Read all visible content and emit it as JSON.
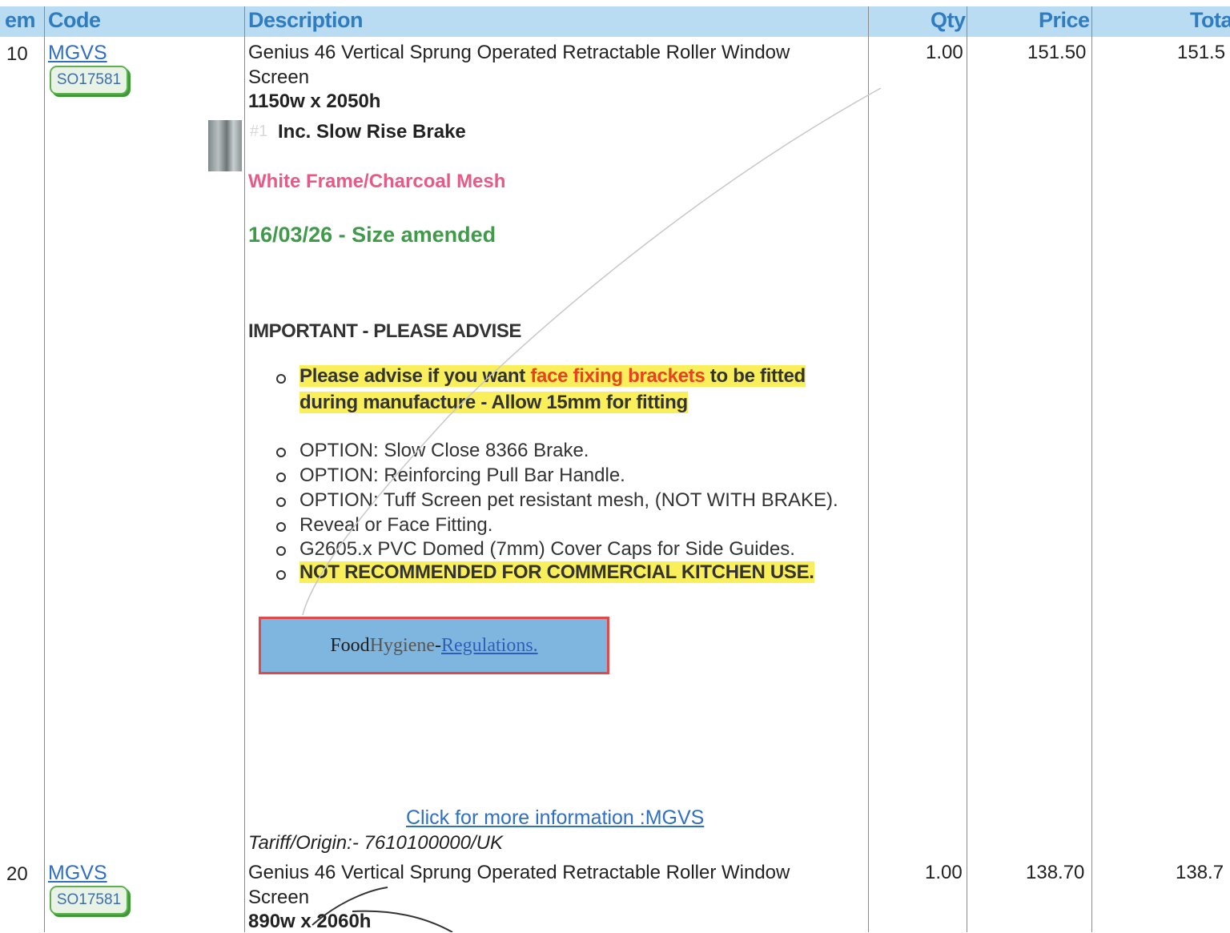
{
  "header": {
    "item": "em",
    "code": "Code",
    "description": "Description",
    "qty": "Qty",
    "price": "Price",
    "total": "Tota"
  },
  "rows": [
    {
      "item": "10",
      "code": "MGVS",
      "so": "SO17581",
      "desc_line1": "Genius 46 Vertical Sprung Operated Retractable Roller Window",
      "desc_line2": "Screen",
      "size": "1150w x 2050h",
      "option_num": "#1",
      "option": "Inc. Slow Rise Brake",
      "color": "White Frame/Charcoal Mesh",
      "note": "16/03/26 - Size amended",
      "important": "IMPORTANT - PLEASE ADVISE",
      "advise_a": "Please advise if you want ",
      "advise_b": "face fixing brackets",
      "advise_c": " to be fitted",
      "advise_d": "during manufacture - Allow 15mm for fitting",
      "options": [
        "OPTION: Slow Close 8366 Brake.",
        "OPTION: Reinforcing Pull Bar Handle.",
        "OPTION: Tuff Screen pet resistant mesh, (NOT WITH BRAKE).",
        "Reveal or Face Fitting.",
        "G2605.x PVC Domed (7mm) Cover Caps for Side Guides."
      ],
      "warning": "NOT RECOMMENDED FOR COMMERCIAL KITCHEN USE.",
      "food_a": "Food ",
      "food_b": "Hygiene",
      "food_c": " - ",
      "food_link": "Regulations.",
      "more_info": "Click for more information :MGVS",
      "tariff": "Tariff/Origin:- 7610100000/UK",
      "qty": "1.00",
      "price": "151.50",
      "total": "151.5"
    },
    {
      "item": "20",
      "code": "MGVS",
      "so": "SO17581",
      "desc_line1": "Genius 46 Vertical Sprung Operated Retractable Roller Window",
      "desc_line2": "Screen",
      "size": "890w x 2060h",
      "qty": "1.00",
      "price": "138.70",
      "total": "138.7"
    }
  ]
}
